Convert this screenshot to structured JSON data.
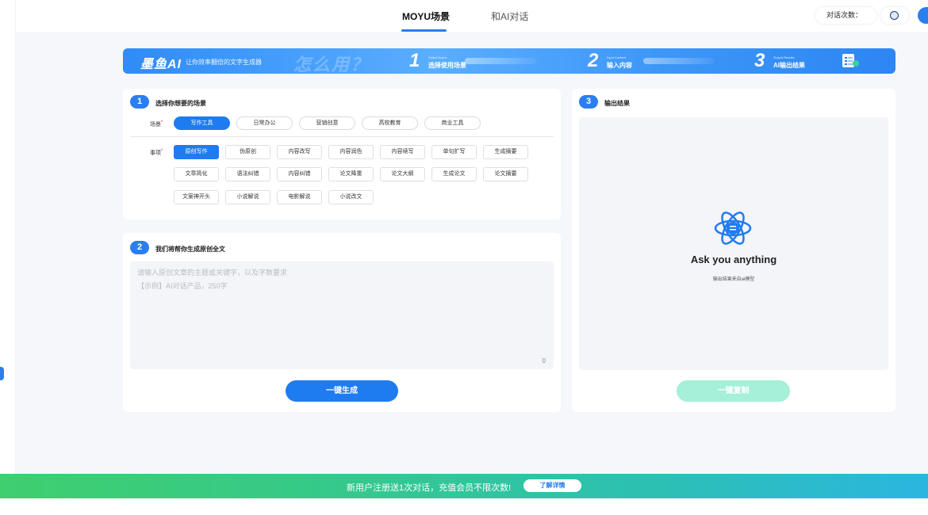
{
  "nav": {
    "tabs": [
      {
        "label": "MOYU场景",
        "active": true
      },
      {
        "label": "和AI对话",
        "active": false
      }
    ],
    "usage_label": "对话次数："
  },
  "banner": {
    "brand": "墨鱼AI",
    "slogan": "让你效率翻倍的文字生成器",
    "howto": "怎么用？",
    "steps": [
      {
        "num": "1",
        "en": "Select Scene",
        "cn": "选择使用场景"
      },
      {
        "num": "2",
        "en": "Input Content",
        "cn": "输入内容"
      },
      {
        "num": "3",
        "en": "Output Results",
        "cn": "AI输出结果"
      }
    ]
  },
  "section1": {
    "num": "1",
    "title": "选择你想要的场景",
    "scene_label": "场景",
    "scenes": [
      {
        "label": "写作工具",
        "active": true
      },
      {
        "label": "日常办公",
        "active": false
      },
      {
        "label": "营销创意",
        "active": false
      },
      {
        "label": "高校教育",
        "active": false
      },
      {
        "label": "商业工具",
        "active": false
      }
    ],
    "item_label": "事项",
    "items": [
      {
        "label": "原创写作",
        "active": true
      },
      {
        "label": "伪原创",
        "active": false
      },
      {
        "label": "内容改写",
        "active": false
      },
      {
        "label": "内容润色",
        "active": false
      },
      {
        "label": "内容续写",
        "active": false
      },
      {
        "label": "单句扩写",
        "active": false
      },
      {
        "label": "生成摘要",
        "active": false
      },
      {
        "label": "文章简化",
        "active": false
      },
      {
        "label": "语法纠错",
        "active": false
      },
      {
        "label": "内容纠错",
        "active": false
      },
      {
        "label": "论文降重",
        "active": false
      },
      {
        "label": "论文大纲",
        "active": false
      },
      {
        "label": "生成论文",
        "active": false
      },
      {
        "label": "论文摘要",
        "active": false
      },
      {
        "label": "文案神开头",
        "active": false
      },
      {
        "label": "小说解说",
        "active": false
      },
      {
        "label": "电影解说",
        "active": false
      },
      {
        "label": "小说改文",
        "active": false
      }
    ]
  },
  "section2": {
    "num": "2",
    "title": "我们将帮你生成原创全文",
    "placeholder_line1": "请输入原创文章的主题或关键字，以及字数要求",
    "placeholder_line2": "【示例】AI对话产品，250字",
    "char_count": "0",
    "generate_label": "一键生成"
  },
  "section3": {
    "num": "3",
    "title": "输出结果",
    "empty_title": "Ask you anything",
    "empty_sub": "输出结果来自ai模型",
    "copy_label": "一键复制"
  },
  "promo": {
    "text": "新用户注册送1次对话，充值会员不限次数!",
    "detail_label": "了解详情"
  },
  "colors": {
    "primary": "#1f7cf0",
    "copy_disabled": "#a6efd8",
    "promo_start": "#3fcf6f",
    "promo_end": "#2bb6e0"
  }
}
